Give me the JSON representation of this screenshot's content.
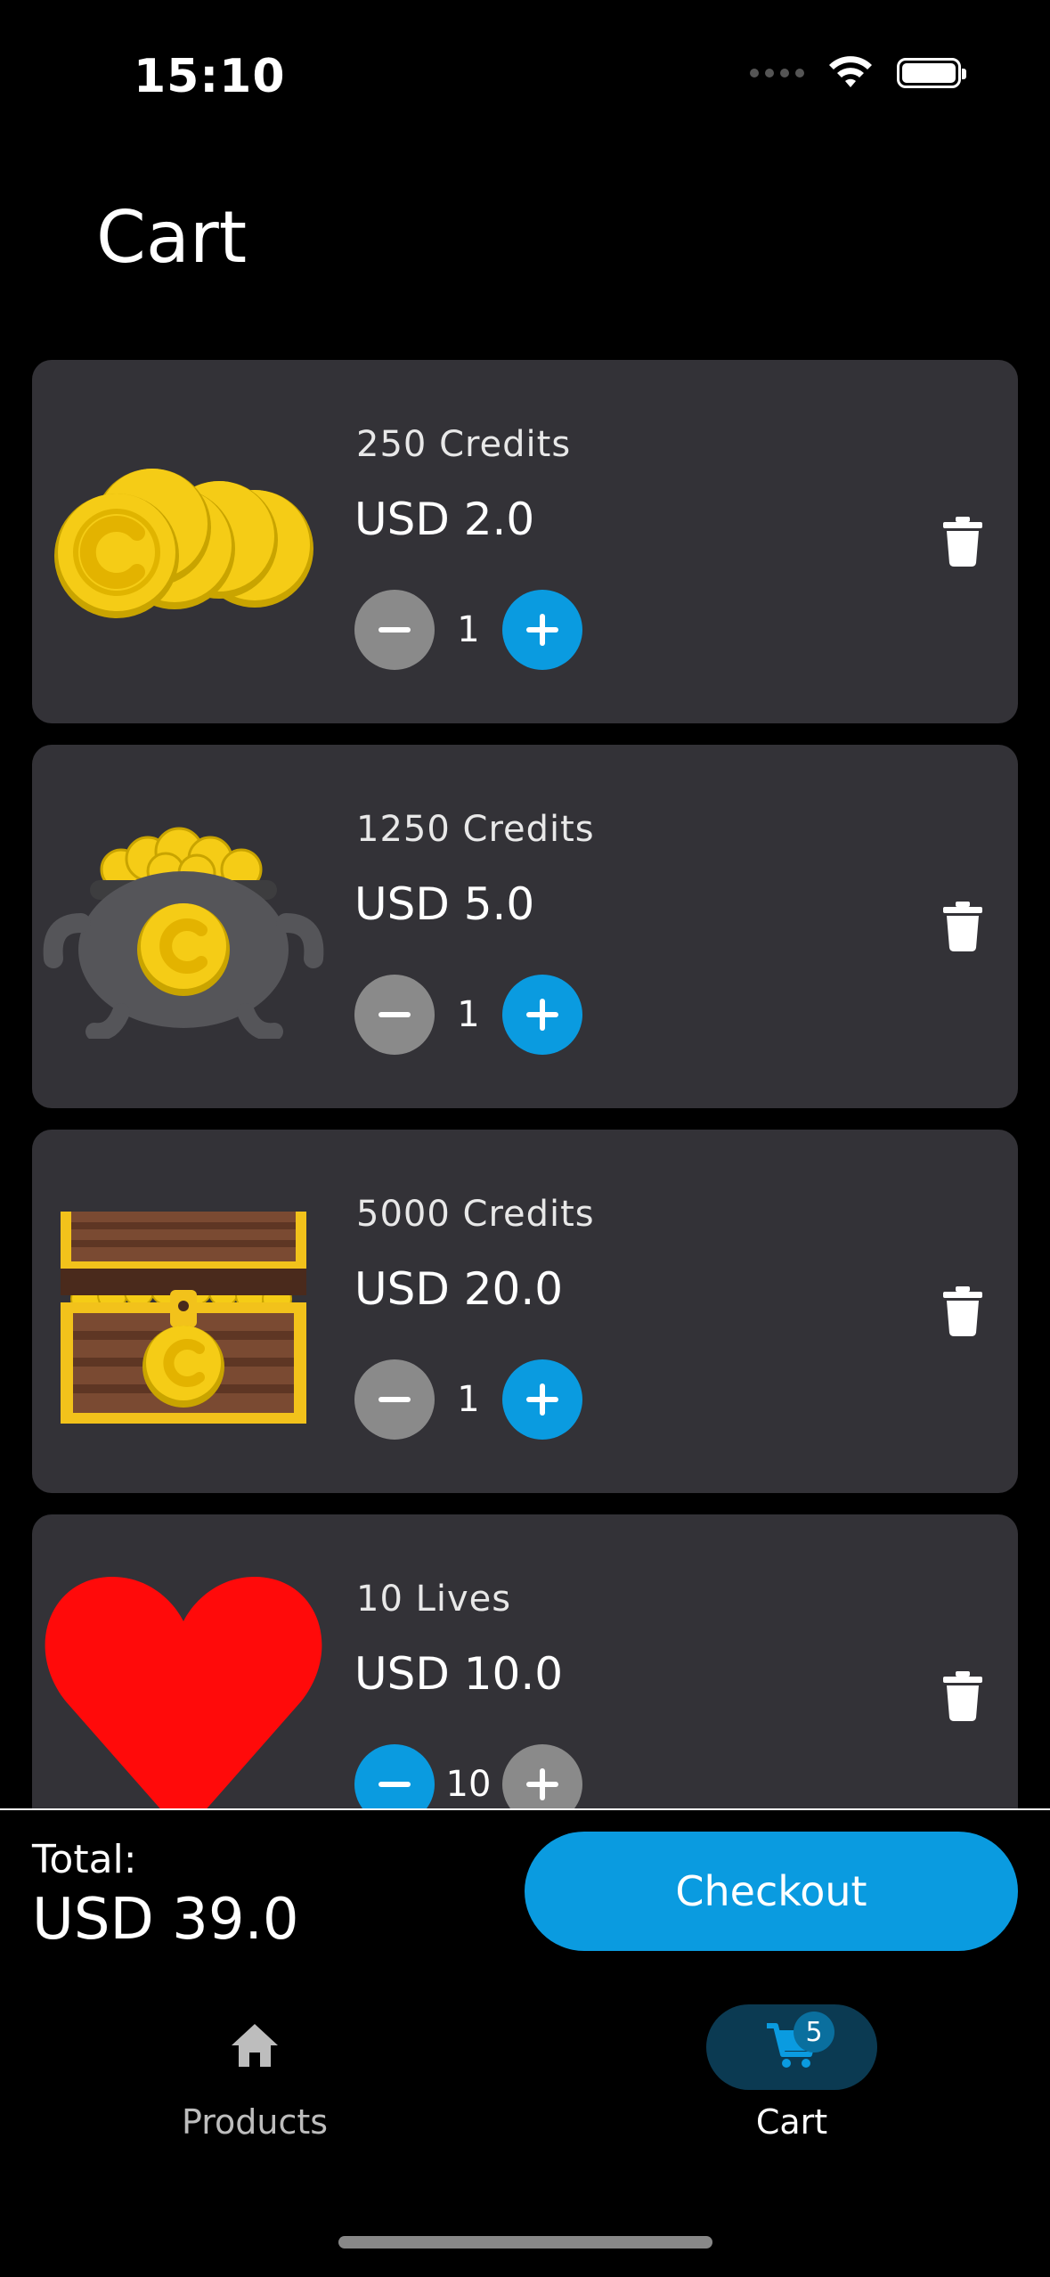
{
  "status_bar": {
    "time": "15:10",
    "icons": [
      "cellular-dots-icon",
      "wifi-icon",
      "battery-icon"
    ]
  },
  "page": {
    "title": "Cart"
  },
  "cart": {
    "items": [
      {
        "name": "250 Credits",
        "price": "USD 2.0",
        "quantity": "1",
        "image": "coin-stack-icon",
        "decrease_enabled": false,
        "increase_enabled": true
      },
      {
        "name": "1250 Credits",
        "price": "USD 5.0",
        "quantity": "1",
        "image": "coin-cauldron-icon",
        "decrease_enabled": false,
        "increase_enabled": true
      },
      {
        "name": "5000 Credits",
        "price": "USD 20.0",
        "quantity": "1",
        "image": "treasure-chest-icon",
        "decrease_enabled": false,
        "increase_enabled": true
      },
      {
        "name": "10 Lives",
        "price": "USD 10.0",
        "quantity": "10",
        "image": "heart-icon",
        "decrease_enabled": true,
        "increase_enabled": false
      }
    ]
  },
  "summary": {
    "total_label": "Total:",
    "total_value": "USD 39.0",
    "checkout_label": "Checkout"
  },
  "tab_bar": {
    "tabs": [
      {
        "label": "Products",
        "icon": "home-icon",
        "active": false
      },
      {
        "label": "Cart",
        "icon": "cart-icon",
        "active": true,
        "badge": "5"
      }
    ]
  },
  "colors": {
    "accent": "#0a9be0",
    "card": "#333237",
    "background": "#000000",
    "disabled": "#8a8a8a",
    "active_tab_pill": "#0b3a52"
  }
}
